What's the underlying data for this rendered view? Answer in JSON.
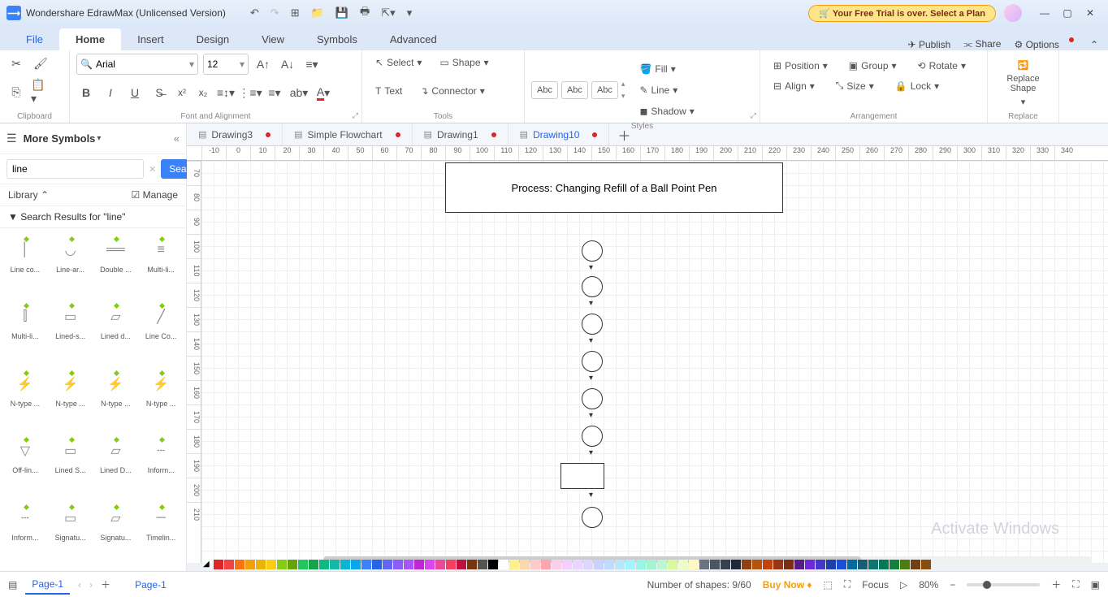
{
  "titlebar": {
    "app_title": "Wondershare EdrawMax (Unlicensed Version)",
    "trial_text": "Your Free Trial is over. Select a Plan"
  },
  "menu": {
    "file": "File",
    "home": "Home",
    "insert": "Insert",
    "design": "Design",
    "view": "View",
    "symbols": "Symbols",
    "advanced": "Advanced",
    "publish": "Publish",
    "share": "Share",
    "options": "Options"
  },
  "ribbon": {
    "font_name": "Arial",
    "font_size": "12",
    "select": "Select",
    "shape": "Shape",
    "text": "Text",
    "connector": "Connector",
    "abc1": "Abc",
    "abc2": "Abc",
    "abc3": "Abc",
    "fill": "Fill",
    "line": "Line",
    "shadow": "Shadow",
    "position": "Position",
    "align": "Align",
    "group": "Group",
    "size": "Size",
    "rotate": "Rotate",
    "lock": "Lock",
    "replace_shape": "Replace Shape",
    "g_clipboard": "Clipboard",
    "g_font": "Font and Alignment",
    "g_tools": "Tools",
    "g_styles": "Styles",
    "g_arrangement": "Arrangement",
    "g_replace": "Replace"
  },
  "doctabs": [
    {
      "label": "Drawing3",
      "dirty": true,
      "active": false
    },
    {
      "label": "Simple Flowchart",
      "dirty": true,
      "active": false
    },
    {
      "label": "Drawing1",
      "dirty": true,
      "active": false
    },
    {
      "label": "Drawing10",
      "dirty": true,
      "active": true
    }
  ],
  "sidebar": {
    "title": "More Symbols",
    "search_value": "line",
    "search_btn": "Search",
    "library": "Library",
    "manage": "Manage",
    "results_label": "Search Results for  \"line\"",
    "shapes": [
      "Line co...",
      "Line-ar...",
      "Double ...",
      "Multi-li...",
      "Multi-li...",
      "Lined-s...",
      "Lined d...",
      "Line Co...",
      "N-type ...",
      "N-type ...",
      "N-type ...",
      "N-type ...",
      "Off-lin...",
      "Lined S...",
      "Lined D...",
      "Inform...",
      "Inform...",
      "Signatu...",
      "Signatu...",
      "Timelin..."
    ]
  },
  "ruler_h": [
    "-10",
    "0",
    "10",
    "20",
    "30",
    "40",
    "50",
    "60",
    "70",
    "80",
    "90",
    "100",
    "110",
    "120",
    "130",
    "140",
    "150",
    "160",
    "170",
    "180",
    "190",
    "200",
    "210",
    "220",
    "230",
    "240",
    "250",
    "260",
    "270",
    "280",
    "290",
    "300",
    "310",
    "320",
    "330",
    "340"
  ],
  "ruler_v": [
    "70",
    "80",
    "90",
    "100",
    "110",
    "120",
    "130",
    "140",
    "150",
    "160",
    "170",
    "180",
    "190",
    "200",
    "210"
  ],
  "canvas": {
    "title_text": "Process: Changing Refill of a Ball Point Pen",
    "watermark": "Activate Windows"
  },
  "status": {
    "page_label": "Page-1",
    "page_info": "Page-1",
    "shapes": "Number of shapes: 9/60",
    "buy": "Buy Now",
    "focus": "Focus",
    "zoom": "80%"
  },
  "colors": [
    "#dc2626",
    "#ef4444",
    "#f97316",
    "#f59e0b",
    "#eab308",
    "#facc15",
    "#84cc16",
    "#65a30d",
    "#22c55e",
    "#16a34a",
    "#10b981",
    "#14b8a6",
    "#06b6d4",
    "#0ea5e9",
    "#3b82f6",
    "#2563eb",
    "#6366f1",
    "#8b5cf6",
    "#a855f7",
    "#c026d3",
    "#d946ef",
    "#ec4899",
    "#f43f5e",
    "#be123c",
    "#78350f",
    "#57534e",
    "#000000",
    "#ffffff",
    "#fef08a",
    "#fed7aa",
    "#fecaca",
    "#fda4af",
    "#fbcfe8",
    "#f5d0fe",
    "#e9d5ff",
    "#ddd6fe",
    "#c7d2fe",
    "#bfdbfe",
    "#bae6fd",
    "#a5f3fc",
    "#99f6e4",
    "#a7f3d0",
    "#bbf7d0",
    "#d9f99d",
    "#ecfccb",
    "#fef9c3",
    "#6b7280",
    "#4b5563",
    "#374151",
    "#1f2937",
    "#92400e",
    "#b45309",
    "#c2410c",
    "#9a3412",
    "#7c2d12",
    "#581c87",
    "#6d28d9",
    "#4338ca",
    "#1e40af",
    "#1d4ed8",
    "#0369a1",
    "#155e75",
    "#0f766e",
    "#047857",
    "#15803d",
    "#4d7c0f",
    "#713f12",
    "#854d0e"
  ]
}
